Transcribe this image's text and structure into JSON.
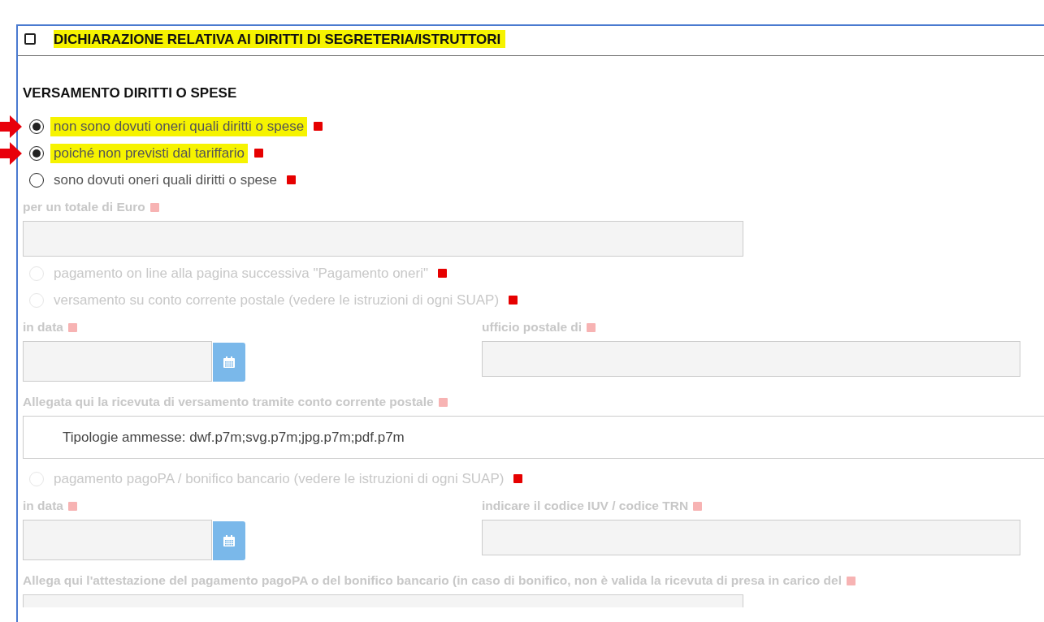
{
  "section": {
    "title": "DICHIARAZIONE RELATIVA AI DIRITTI DI SEGRETERIA/ISTRUTTORI",
    "checked": false,
    "highlighted": true
  },
  "subtitle": "VERSAMENTO DIRITTI O SPESE",
  "rows": [
    {
      "kind": "radio",
      "label": "non sono dovuti oneri quali diritti o spese",
      "selected": true,
      "disabled": false,
      "highlighted": true,
      "marked": true
    },
    {
      "kind": "radio",
      "label": "poiché non previsti dal tariffario",
      "selected": true,
      "disabled": false,
      "highlighted": true,
      "marked": true
    },
    {
      "kind": "radio",
      "label": "sono dovuti oneri quali diritti o spese",
      "selected": false,
      "disabled": false,
      "highlighted": false,
      "marked": false
    },
    {
      "kind": "label",
      "label": "per un totale di Euro",
      "disabled": true
    },
    {
      "kind": "input",
      "disabled": true
    },
    {
      "kind": "radio",
      "label": "pagamento on line alla pagina successiva \"Pagamento oneri\"",
      "selected": false,
      "disabled": true,
      "highlighted": false,
      "marked": false
    },
    {
      "kind": "radio",
      "label": "versamento su conto corrente postale (vedere le istruzioni di ogni SUAP)",
      "selected": false,
      "disabled": true,
      "highlighted": false,
      "marked": false
    },
    {
      "kind": "pair",
      "left": {
        "label": "in data",
        "kind": "date"
      },
      "right": {
        "label": "ufficio postale di",
        "kind": "text"
      },
      "disabled": true
    },
    {
      "kind": "label",
      "label": "Allegata qui la ricevuta di versamento tramite conto corrente postale",
      "disabled": true
    },
    {
      "kind": "file",
      "text": "Tipologie ammesse: dwf.p7m;svg.p7m;jpg.p7m;pdf.p7m"
    },
    {
      "kind": "radio",
      "label": "pagamento pagoPA / bonifico bancario (vedere le istruzioni di ogni SUAP)",
      "selected": false,
      "disabled": true,
      "highlighted": false,
      "marked": false
    },
    {
      "kind": "pair",
      "left": {
        "label": "in data",
        "kind": "date"
      },
      "right": {
        "label": "indicare il codice IUV / codice TRN",
        "kind": "text"
      },
      "disabled": true
    },
    {
      "kind": "label",
      "label": "Allega qui l'attestazione del pagamento pagoPA o del bonifico bancario (in caso di bonifico, non è valida la ricevuta di presa in carico del",
      "disabled": true
    },
    {
      "kind": "input",
      "disabled": true
    }
  ]
}
